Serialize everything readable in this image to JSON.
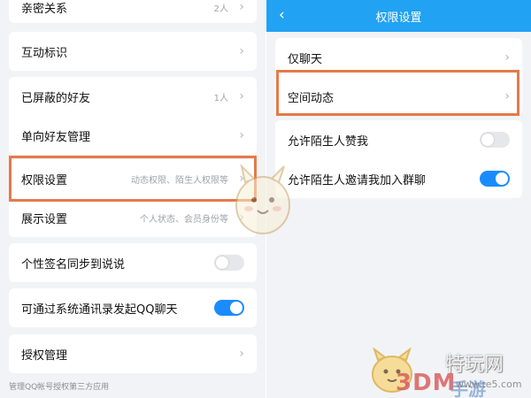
{
  "left_panel": {
    "rows": [
      {
        "label": "亲密关系",
        "value": "2人"
      },
      {
        "label": "互动标识",
        "value": ""
      },
      {
        "label": "已屏蔽的好友",
        "value": "1人"
      },
      {
        "label": "单向好友管理",
        "value": ""
      },
      {
        "label": "权限设置",
        "value": "动态权限、陌生人权限等"
      },
      {
        "label": "展示设置",
        "value": "个人状态、会员身份等"
      },
      {
        "label": "个性签名同步到说说",
        "toggle": "off"
      },
      {
        "label": "可通过系统通讯录发起QQ聊天",
        "toggle": "on"
      },
      {
        "label": "授权管理",
        "value": ""
      }
    ],
    "footer": "管理QQ帐号授权第三方应用"
  },
  "right_panel": {
    "title": "权限设置",
    "rows": [
      {
        "label": "仅聊天"
      },
      {
        "label": "空间动态"
      },
      {
        "label": "允许陌生人赞我",
        "toggle": "off"
      },
      {
        "label": "允许陌生人邀请我加入群聊",
        "toggle": "on"
      }
    ]
  },
  "watermark": {
    "brand": "3DM",
    "brand_suffix": "手游",
    "site_cn": "特玩网",
    "site_url": "www.te5.com"
  },
  "colors": {
    "accent": "#21a2f3",
    "toggle_on": "#1a8cff",
    "highlight": "#e47a4a",
    "background": "#f2f3f6"
  },
  "icons": {
    "chevron": "chevron-right-icon",
    "back": "back-arrow-icon"
  }
}
